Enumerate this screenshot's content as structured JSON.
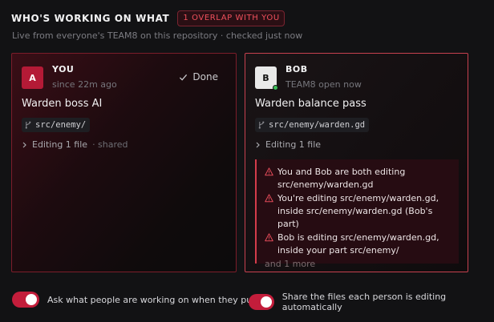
{
  "header": {
    "title": "WHO'S WORKING ON WHAT",
    "overlap_badge": "1 OVERLAP WITH YOU",
    "subtitle": "Live from everyone's TEAM8 on this repository · checked just now"
  },
  "cards": [
    {
      "avatar": "A",
      "name": "YOU",
      "meta": "since 22m ago",
      "action": "Done",
      "task": "Warden boss AI",
      "path": "src/enemy/",
      "editing": "Editing 1 file",
      "editing_suffix": "· shared",
      "accent": "#b41a36"
    },
    {
      "avatar": "B",
      "name": "BOB",
      "meta": "TEAM8 open now",
      "task": "Warden balance pass",
      "path": "src/enemy/warden.gd",
      "editing": "Editing 1 file",
      "online": true,
      "warnings": [
        "You and Bob are both editing src/enemy/warden.gd",
        "You're editing src/enemy/warden.gd, inside src/enemy/warden.gd (Bob's part)",
        "Bob is editing src/enemy/warden.gd, inside your part src/enemy/"
      ],
      "more": "and 1 more"
    }
  ],
  "settings": {
    "ask_on_pull": {
      "label": "Ask what people are working on when they pull",
      "enabled": true
    },
    "share_files": {
      "label": "Share the files each person is editing automatically",
      "enabled": true
    }
  },
  "colors": {
    "accent": "#c31d3b",
    "warning": "#e04a58",
    "online": "#3fbf5a"
  },
  "icons": {
    "done": "check-icon",
    "path": "branch-icon",
    "editing": "chevron-right-icon",
    "warning": "warning-triangle-icon"
  }
}
